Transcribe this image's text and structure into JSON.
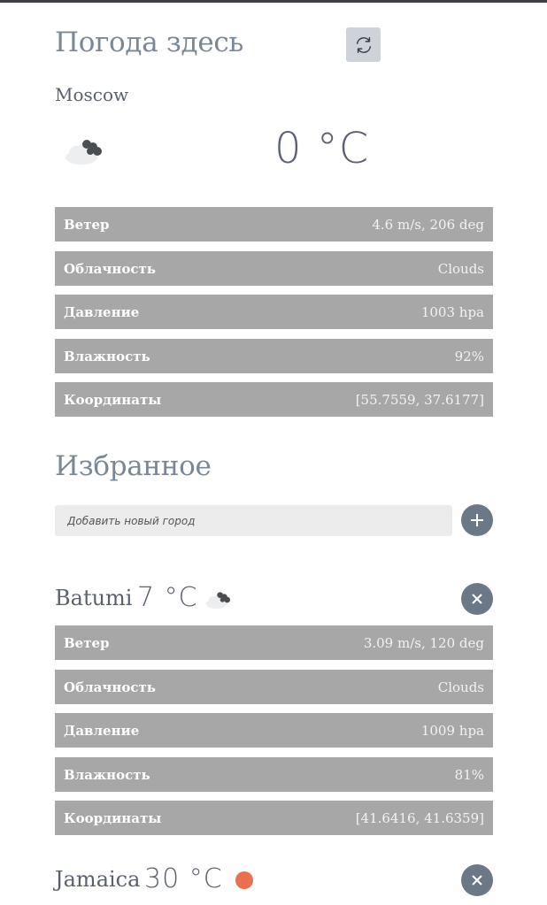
{
  "current": {
    "title": "Погода здесь",
    "city": "Moscow",
    "temperature": "0 °C",
    "icon": "cloud-icon",
    "details": [
      {
        "label": "Ветер",
        "value": "4.6 m/s, 206 deg"
      },
      {
        "label": "Облачность",
        "value": "Clouds"
      },
      {
        "label": "Давление",
        "value": "1003 hpa"
      },
      {
        "label": "Влажность",
        "value": "92%"
      },
      {
        "label": "Координаты",
        "value": "[55.7559, 37.6177]"
      }
    ]
  },
  "favorites": {
    "title": "Избранное",
    "input_placeholder": "Добавить новый город",
    "cities": [
      {
        "city": "Batumi",
        "temperature": "7 °C",
        "icon": "cloud-icon",
        "details": [
          {
            "label": "Ветер",
            "value": "3.09 m/s, 120 deg"
          },
          {
            "label": "Облачность",
            "value": "Clouds"
          },
          {
            "label": "Давление",
            "value": "1009 hpa"
          },
          {
            "label": "Влажность",
            "value": "81%"
          },
          {
            "label": "Координаты",
            "value": "[41.6416, 41.6359]"
          }
        ]
      },
      {
        "city": "Jamaica",
        "temperature": "30 °C",
        "icon": "sun-icon"
      }
    ]
  },
  "colors": {
    "heading": "#7a8896",
    "row_bg": "#a7a7a7",
    "button_bg": "#6a7888",
    "sun": "#e8704f"
  }
}
